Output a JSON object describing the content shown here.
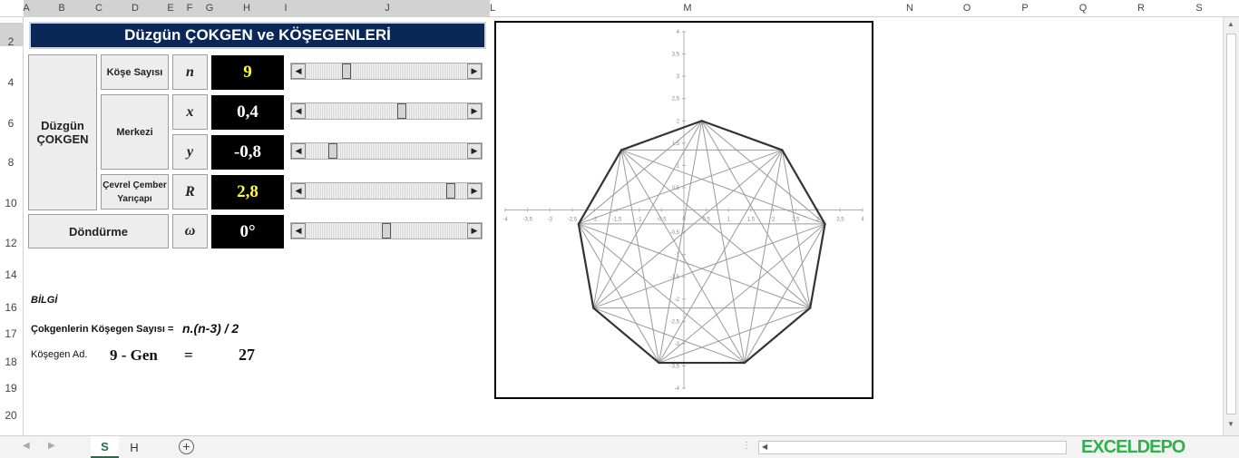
{
  "columns": [
    "A",
    "B",
    "C",
    "D",
    "E",
    "F",
    "G",
    "H",
    "I",
    "J",
    "L",
    "M",
    "N",
    "O",
    "P",
    "Q",
    "R",
    "S"
  ],
  "rows": [
    "2",
    "4",
    "6",
    "8",
    "10",
    "12",
    "14",
    "16",
    "17",
    "18",
    "19",
    "20"
  ],
  "title": "Düzgün ÇOKGEN  ve  KÖŞEGENLERİ",
  "section_label": "Düzgün ÇOKGEN",
  "params": [
    {
      "label": "Köşe Sayısı",
      "symbol": "n",
      "value": "9",
      "value_color": "#ffff33",
      "scroll_level": 0.24
    },
    {
      "label": "Merkezi",
      "symbol": "x",
      "value": "0,4",
      "value_color": "#ffffff",
      "scroll_level": 0.6
    },
    {
      "label": "",
      "symbol": "y",
      "value": "-0,8",
      "value_color": "#ffffff",
      "scroll_level": 0.15
    },
    {
      "label": "Çevrel Çember Yarıçapı",
      "symbol": "R",
      "value": "2,8",
      "value_color": "#ffff33",
      "scroll_level": 0.92
    },
    {
      "label": "Döndürme",
      "symbol": "ω",
      "value": "0°",
      "value_color": "#ffffff",
      "scroll_level": 0.5
    }
  ],
  "info": {
    "heading": "BİLGİ",
    "formula_label": "Çokgenlerin  Köşegen Sayısı  =",
    "formula": "n.(n-3) / 2",
    "diag_label": "Köşegen Ad.",
    "polygon_name": "9 - Gen",
    "equals": "=",
    "diag_count": "27"
  },
  "sheet_tabs": [
    {
      "label": "S",
      "active": true
    },
    {
      "label": "H",
      "active": false
    }
  ],
  "add_sheet_icon": "plus-circle-icon",
  "watermark": "EXCELDEPO",
  "chart_data": {
    "type": "scatter",
    "title": "",
    "xlabel": "",
    "ylabel": "",
    "xlim": [
      -4,
      4
    ],
    "ylim": [
      -4,
      4
    ],
    "x_ticks": [
      "-4",
      "-3,5",
      "-3",
      "-2,5",
      "-2",
      "-1,5",
      "-1",
      "-0,5",
      "0",
      "0,5",
      "1",
      "1,5",
      "2",
      "2,5",
      "3",
      "3,5",
      "4"
    ],
    "y_ticks": [
      "-4",
      "-3,5",
      "-3",
      "-2,5",
      "-2",
      "-1,5",
      "-1",
      "-0,5",
      "0",
      "0,5",
      "1",
      "1,5",
      "2",
      "2,5",
      "3",
      "3,5",
      "4"
    ],
    "grid": false,
    "n": 9,
    "center": [
      0.4,
      -0.8
    ],
    "radius": 2.8,
    "rotation_deg": 0,
    "series": [
      {
        "values": [
          [
            0.4,
            2.0
          ],
          [
            2.2,
            1.345
          ],
          [
            3.158,
            -0.314
          ],
          [
            2.826,
            -2.2
          ],
          [
            1.358,
            -3.431
          ],
          [
            -0.558,
            -3.431
          ],
          [
            -2.026,
            -2.2
          ],
          [
            -2.358,
            -0.314
          ],
          [
            -1.4,
            1.345
          ]
        ],
        "style": "polygon",
        "color": "#333333"
      },
      {
        "values": [],
        "style": "diagonals",
        "color": "#999999"
      }
    ]
  }
}
